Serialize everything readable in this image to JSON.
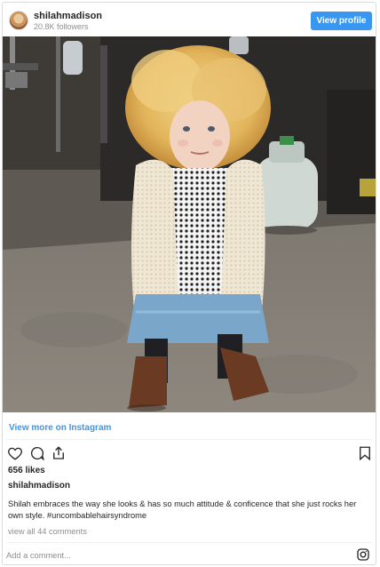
{
  "header": {
    "username": "shilahmadison",
    "followers": "20.8K followers",
    "view_profile_label": "View profile"
  },
  "post": {
    "view_more_label": "View more on Instagram",
    "likes": "656 likes",
    "caption_user": "shilahmadison",
    "caption": "Shilah embraces the way she looks & has so much attitude & conficence that she just rocks her own style. #uncombablehairsyndrome",
    "view_comments_label": "view all 44 comments",
    "comment_placeholder": "Add a comment...",
    "icons": [
      "heart-icon",
      "comment-icon",
      "share-icon",
      "bookmark-icon",
      "instagram-icon"
    ]
  },
  "colors": {
    "accent": "#3897f0",
    "text": "#262626",
    "muted": "#8e8e8e",
    "border": "#dbdbdb"
  }
}
